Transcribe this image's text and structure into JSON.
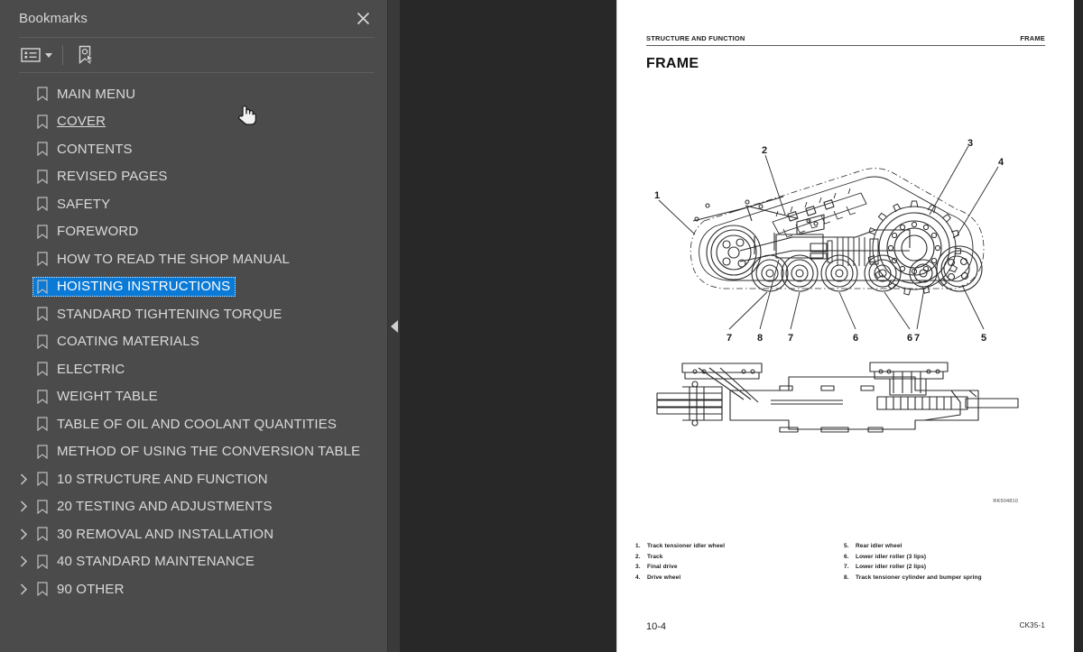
{
  "panel": {
    "title": "Bookmarks",
    "close_icon": "close-icon",
    "toolbar": {
      "options_label": "options-list-icon",
      "new_bookmark_label": "new-bookmark-icon"
    },
    "items": [
      {
        "label": "MAIN MENU",
        "expandable": false,
        "selected": false,
        "visited": false
      },
      {
        "label": "COVER",
        "expandable": false,
        "selected": false,
        "visited": true
      },
      {
        "label": "CONTENTS",
        "expandable": false,
        "selected": false,
        "visited": false
      },
      {
        "label": "REVISED PAGES",
        "expandable": false,
        "selected": false,
        "visited": false
      },
      {
        "label": "SAFETY",
        "expandable": false,
        "selected": false,
        "visited": false
      },
      {
        "label": "FOREWORD",
        "expandable": false,
        "selected": false,
        "visited": false
      },
      {
        "label": "HOW TO READ THE SHOP MANUAL",
        "expandable": false,
        "selected": false,
        "visited": false
      },
      {
        "label": "HOISTING INSTRUCTIONS",
        "expandable": false,
        "selected": true,
        "visited": false
      },
      {
        "label": "STANDARD TIGHTENING TORQUE",
        "expandable": false,
        "selected": false,
        "visited": false
      },
      {
        "label": "COATING MATERIALS",
        "expandable": false,
        "selected": false,
        "visited": false
      },
      {
        "label": "ELECTRIC",
        "expandable": false,
        "selected": false,
        "visited": false
      },
      {
        "label": "WEIGHT TABLE",
        "expandable": false,
        "selected": false,
        "visited": false
      },
      {
        "label": "TABLE OF OIL AND COOLANT QUANTITIES",
        "expandable": false,
        "selected": false,
        "visited": false
      },
      {
        "label": "METHOD OF USING THE CONVERSION TABLE",
        "expandable": false,
        "selected": false,
        "visited": false
      },
      {
        "label": "10 STRUCTURE AND FUNCTION",
        "expandable": true,
        "selected": false,
        "visited": false
      },
      {
        "label": "20 TESTING AND ADJUSTMENTS",
        "expandable": true,
        "selected": false,
        "visited": false
      },
      {
        "label": "30 REMOVAL AND INSTALLATION",
        "expandable": true,
        "selected": false,
        "visited": false
      },
      {
        "label": "40 STANDARD MAINTENANCE",
        "expandable": true,
        "selected": false,
        "visited": false
      },
      {
        "label": "90 OTHER",
        "expandable": true,
        "selected": false,
        "visited": false
      }
    ]
  },
  "splitter": {
    "collapse_icon": "collapse-left-triangle-icon"
  },
  "document": {
    "header_left": "STRUCTURE AND FUNCTION",
    "header_right": "FRAME",
    "title": "FRAME",
    "figure_code": "RK504810",
    "figure_main_callouts": [
      "1",
      "2",
      "3",
      "4",
      "5",
      "6",
      "7",
      "8"
    ],
    "legend_left": [
      {
        "num": "1.",
        "text": "Track tensioner idler wheel"
      },
      {
        "num": "2.",
        "text": "Track"
      },
      {
        "num": "3.",
        "text": "Final drive"
      },
      {
        "num": "4.",
        "text": "Drive wheel"
      }
    ],
    "legend_right": [
      {
        "num": "5.",
        "text": "Rear idler wheel"
      },
      {
        "num": "6.",
        "text": "Lower idler roller (3 lips)"
      },
      {
        "num": "7.",
        "text": "Lower idler roller (2 lips)"
      },
      {
        "num": "8.",
        "text": "Track tensioner cylinder and bumper spring"
      }
    ],
    "footer_left": "10-4",
    "footer_right": "CK35-1"
  },
  "colors": {
    "panel_bg": "#4b4b4b",
    "viewer_bg": "#282828",
    "selection": "#0b7ad6",
    "text": "#dadada",
    "page_bg": "#ffffff"
  }
}
